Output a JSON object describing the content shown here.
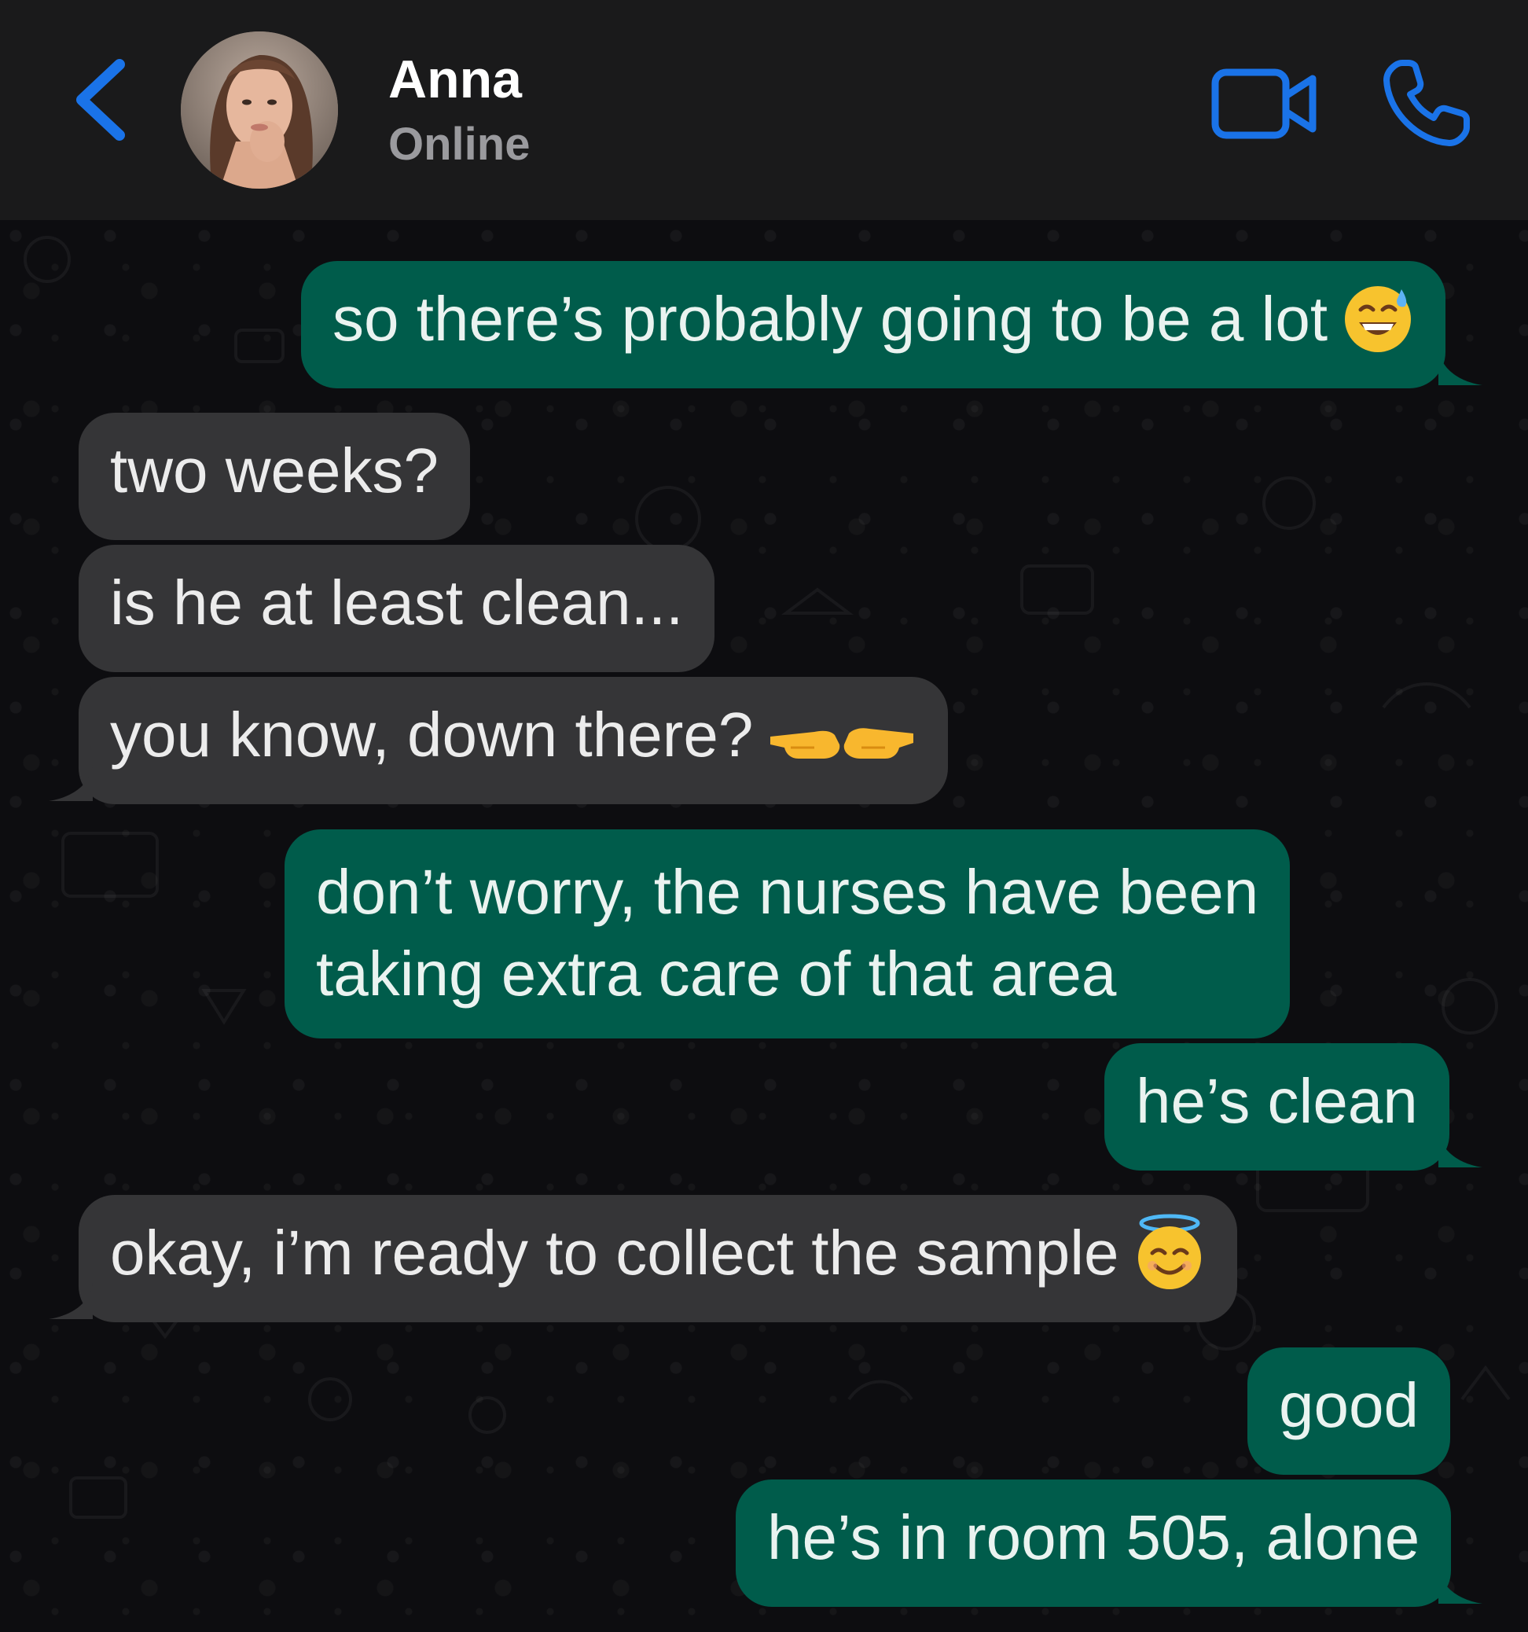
{
  "header": {
    "contact_name": "Anna",
    "status": "Online",
    "accent_color": "#1a73e8"
  },
  "messages": [
    {
      "direction": "out",
      "text": "so there’s probably going to be a lot",
      "emoji": "grinning-face-with-sweat"
    },
    {
      "direction": "in",
      "text": "two weeks?"
    },
    {
      "direction": "in",
      "text": "is he at least clean..."
    },
    {
      "direction": "in",
      "text": "you know, down there?",
      "emoji": "pointing-hands"
    },
    {
      "direction": "out",
      "text_line1": "don’t worry, the nurses have been",
      "text_line2": "taking extra care of that area"
    },
    {
      "direction": "out",
      "text": "he’s clean"
    },
    {
      "direction": "in",
      "text": "okay, i’m ready to collect the sample",
      "emoji": "smiling-face-with-halo"
    },
    {
      "direction": "out",
      "text": "good"
    },
    {
      "direction": "out",
      "text": "he’s in room 505, alone"
    }
  ],
  "colors": {
    "outgoing_bubble": "#005c4b",
    "incoming_bubble": "#353537",
    "header_bg": "#1a1a1b",
    "chat_bg": "#0d0d10"
  }
}
